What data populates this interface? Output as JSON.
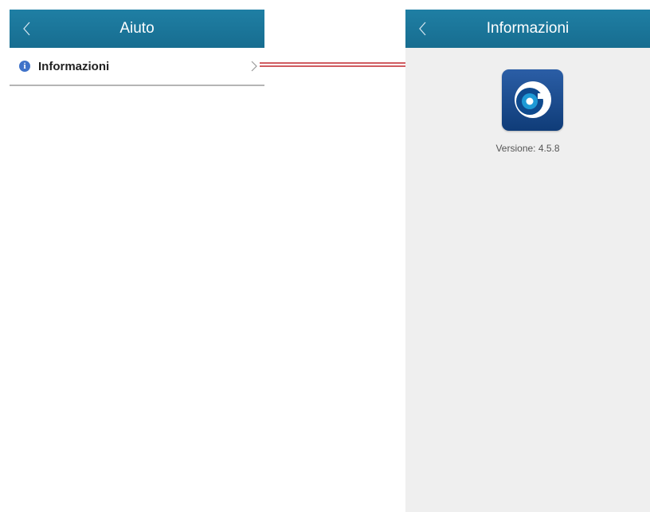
{
  "left_screen": {
    "title": "Aiuto",
    "back_icon": "chevron-left-icon",
    "items": [
      {
        "label": "Informazioni",
        "icon": "info-icon",
        "trailing_icon": "chevron-right-icon"
      }
    ]
  },
  "right_screen": {
    "title": "Informazioni",
    "back_icon": "chevron-left-icon",
    "logo_icon": "app-logo-icon",
    "version": "Versione: 4.5.8"
  },
  "colors": {
    "app_bar": "#1a739a",
    "connector": "#c0272d",
    "info_icon": "#3f72c9",
    "panel_bg": "#efefef"
  }
}
